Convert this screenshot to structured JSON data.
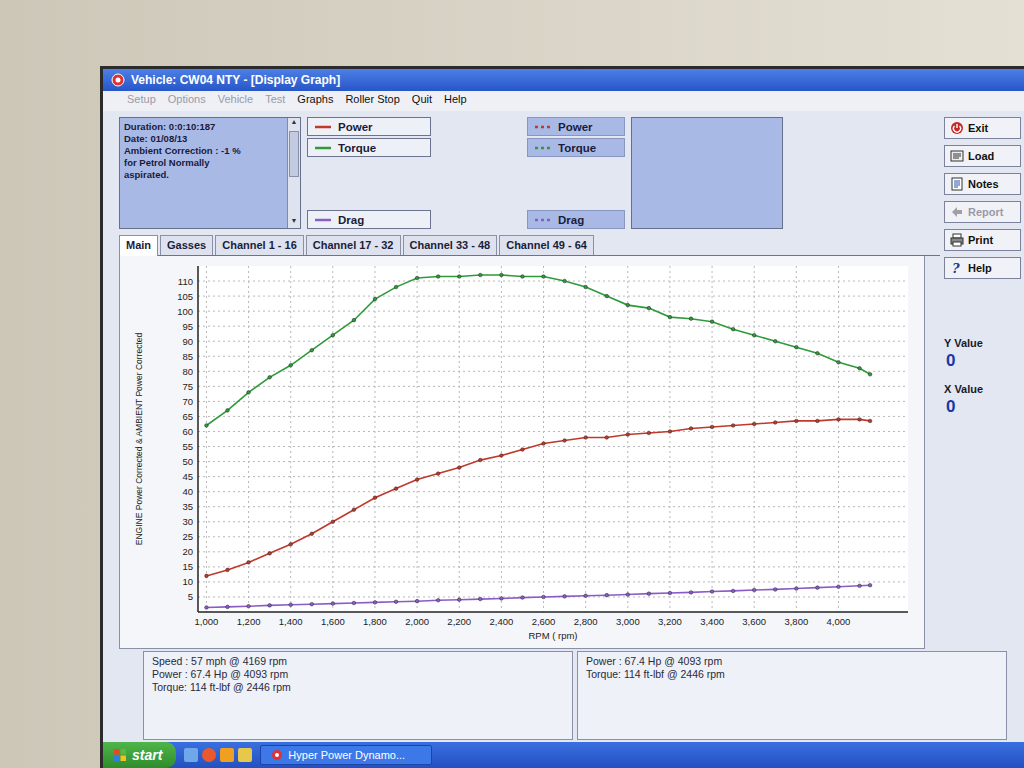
{
  "window": {
    "title": "Vehicle: CW04 NTY - [Display Graph]"
  },
  "menu": [
    {
      "label": "Setup",
      "disabled": true
    },
    {
      "label": "Options",
      "disabled": true
    },
    {
      "label": "Vehicle",
      "disabled": true
    },
    {
      "label": "Test",
      "disabled": true
    },
    {
      "label": "Graphs",
      "disabled": false
    },
    {
      "label": "Roller Stop",
      "disabled": false
    },
    {
      "label": "Quit",
      "disabled": false
    },
    {
      "label": "Help",
      "disabled": false
    }
  ],
  "info": [
    "Duration: 0:0:10:187",
    "Date: 01/08/13",
    "Ambient Correction : -1 %",
    "for Petrol Normally",
    "aspirated."
  ],
  "legends": [
    {
      "kind": "solid",
      "items": [
        {
          "label": "Power",
          "color": "#c0392b"
        },
        {
          "label": "Torque",
          "color": "#2f9a3a"
        },
        {
          "label": "Drag",
          "color": "#8a5cc8"
        }
      ]
    },
    {
      "kind": "dashed",
      "items": [
        {
          "label": "Power",
          "color": "#c0392b"
        },
        {
          "label": "Torque",
          "color": "#2f9a3a"
        },
        {
          "label": "Drag",
          "color": "#8a5cc8"
        }
      ]
    }
  ],
  "side_buttons": [
    {
      "label": "Exit",
      "kind": "exit",
      "disabled": false
    },
    {
      "label": "Load",
      "kind": "load",
      "disabled": false
    },
    {
      "label": "Notes",
      "kind": "notes",
      "disabled": false
    },
    {
      "label": "Report",
      "kind": "report",
      "disabled": true
    },
    {
      "label": "Print",
      "kind": "print",
      "disabled": false
    },
    {
      "label": "Help",
      "kind": "help",
      "disabled": false
    }
  ],
  "tabs": [
    {
      "label": "Main",
      "selected": true
    },
    {
      "label": "Gasses",
      "selected": false
    },
    {
      "label": "Channel 1 - 16",
      "selected": false
    },
    {
      "label": "Channel 17 - 32",
      "selected": false
    },
    {
      "label": "Channel 33 - 48",
      "selected": false
    },
    {
      "label": "Channel 49 - 64",
      "selected": false
    }
  ],
  "chart": {
    "y_label": "ENGINE Power Corrected & AMBIENT Power Corrected",
    "x_label": "RPM ( rpm)",
    "y_ticks": [
      "5",
      "10",
      "15",
      "20",
      "25",
      "30",
      "35",
      "40",
      "45",
      "50",
      "55",
      "60",
      "65",
      "70",
      "75",
      "80",
      "85",
      "90",
      "95",
      "100",
      "105",
      "110"
    ],
    "x_ticks": [
      "1,000",
      "1,200",
      "1,400",
      "1,600",
      "1,800",
      "2,000",
      "2,200",
      "2,400",
      "2,600",
      "2,800",
      "3,000",
      "3,200",
      "3,400",
      "3,600",
      "3,800",
      "4,000"
    ],
    "rpm": [
      1000,
      1100,
      1200,
      1300,
      1400,
      1500,
      1600,
      1700,
      1800,
      1900,
      2000,
      2100,
      2200,
      2300,
      2400,
      2500,
      2600,
      2700,
      2800,
      2900,
      3000,
      3100,
      3200,
      3300,
      3400,
      3500,
      3600,
      3700,
      3800,
      3900,
      4000,
      4100,
      4150
    ],
    "series": [
      {
        "name": "Torque",
        "color": "#2f9a3a",
        "values": [
          62,
          67,
          73,
          78,
          82,
          87,
          92,
          97,
          104,
          108,
          111,
          111.5,
          111.5,
          112,
          112,
          111.5,
          111.5,
          110,
          108,
          105,
          102,
          101,
          98,
          97.5,
          96.5,
          94,
          92,
          90,
          88,
          86,
          83,
          81,
          79
        ]
      },
      {
        "name": "Power",
        "color": "#c0392b",
        "values": [
          12,
          14,
          16.5,
          19.5,
          22.5,
          26,
          30,
          34,
          38,
          41,
          44,
          46,
          48,
          50.5,
          52,
          54,
          56,
          57,
          58,
          58,
          59,
          59.5,
          60,
          61,
          61.5,
          62,
          62.5,
          63,
          63.5,
          63.5,
          64,
          64,
          63.5
        ]
      },
      {
        "name": "Drag",
        "color": "#8a5cc8",
        "values": [
          1.5,
          1.7,
          1.9,
          2.2,
          2.4,
          2.6,
          2.8,
          3.0,
          3.2,
          3.4,
          3.6,
          3.9,
          4.1,
          4.3,
          4.5,
          4.8,
          5.0,
          5.2,
          5.4,
          5.6,
          5.8,
          6.1,
          6.3,
          6.5,
          6.8,
          7.0,
          7.3,
          7.5,
          7.8,
          8.1,
          8.4,
          8.7,
          8.9
        ]
      }
    ]
  },
  "readout": [
    {
      "label": "Y Value",
      "value": "0"
    },
    {
      "label": "X Value",
      "value": "0"
    }
  ],
  "status": [
    [
      "Speed : 57 mph @ 4169 rpm",
      "Power : 67.4 Hp @ 4093 rpm",
      "Torque: 114 ft-lbf @ 2446 rpm"
    ],
    [
      "Power : 67.4 Hp @ 4093 rpm",
      "Torque: 114 ft-lbf @ 2446 rpm"
    ]
  ],
  "taskbar": {
    "start": "start",
    "tasks": [
      "Hyper Power Dynamo..."
    ]
  }
}
